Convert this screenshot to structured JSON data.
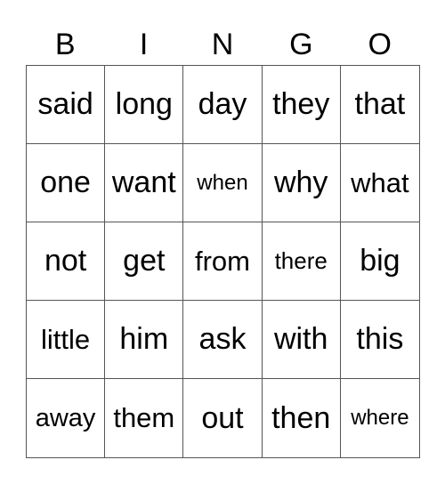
{
  "header": [
    "B",
    "I",
    "N",
    "G",
    "O"
  ],
  "cells": [
    [
      "said",
      "long",
      "day",
      "they",
      "that"
    ],
    [
      "one",
      "want",
      "when",
      "why",
      "what"
    ],
    [
      "not",
      "get",
      "from",
      "there",
      "big"
    ],
    [
      "little",
      "him",
      "ask",
      "with",
      "this"
    ],
    [
      "away",
      "them",
      "out",
      "then",
      "where"
    ]
  ]
}
